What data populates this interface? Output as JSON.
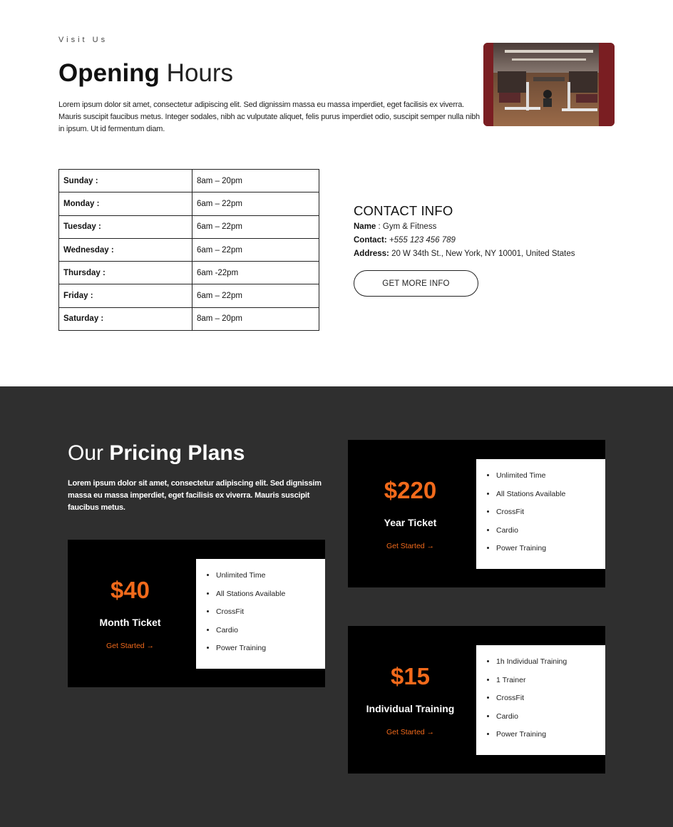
{
  "opening": {
    "eyebrow": "Visit Us",
    "title_bold": "Opening",
    "title_light": " Hours",
    "intro": "Lorem ipsum dolor sit amet, consectetur adipiscing elit. Sed dignissim massa eu massa imperdiet, eget facilisis ex viverra. Mauris suscipit faucibus metus. Integer sodales, nibh ac vulputate aliquet, felis purus imperdiet odio, suscipit semper nulla nibh in ipsum. Ut id fermentum diam.",
    "hours": [
      {
        "day": "Sunday :",
        "time": "8am – 20pm"
      },
      {
        "day": "Monday :",
        "time": "6am – 22pm"
      },
      {
        "day": "Tuesday :",
        "time": "6am – 22pm"
      },
      {
        "day": "Wednesday :",
        "time": "6am – 22pm"
      },
      {
        "day": "Thursday :",
        "time": "6am -22pm"
      },
      {
        "day": "Friday :",
        "time": "6am – 22pm"
      },
      {
        "day": "Saturday :",
        "time": "8am – 20pm"
      }
    ]
  },
  "contact": {
    "heading": "CONTACT INFO",
    "name_label": "Name",
    "name_value": " : Gym & Fitness",
    "contact_label": "Contact",
    "contact_value": "+555 123 456 789",
    "address_label": "Address",
    "address_value": " 20 W 34th St., New York, NY 10001, United States",
    "button_label": "GET MORE INFO"
  },
  "pricing": {
    "title_light": "Our ",
    "title_bold": "Pricing Plans",
    "intro": "Lorem ipsum dolor sit amet, consectetur adipiscing elit. Sed dignissim massa eu massa imperdiet, eget facilisis ex viverra. Mauris suscipit faucibus metus.",
    "plans": [
      {
        "price": "$40",
        "name": "Month Ticket",
        "cta": "Get Started →",
        "features": [
          "Unlimited Time",
          "All Stations Available",
          "CrossFit",
          "Cardio",
          "Power Training"
        ]
      },
      {
        "price": "$220",
        "name": "Year Ticket",
        "cta": "Get Started →",
        "features": [
          "Unlimited Time",
          "All Stations Available",
          "CrossFit",
          "Cardio",
          "Power Training"
        ]
      },
      {
        "price": "$15",
        "name": "Individual Training",
        "cta": "Get Started →",
        "features": [
          "1h Individual Training",
          "1 Trainer",
          "CrossFit",
          "Cardio",
          "Power Training"
        ]
      }
    ]
  },
  "colors": {
    "accent": "#f26a1b",
    "dark_section": "#2f2f2f",
    "card_bg": "#000000"
  }
}
